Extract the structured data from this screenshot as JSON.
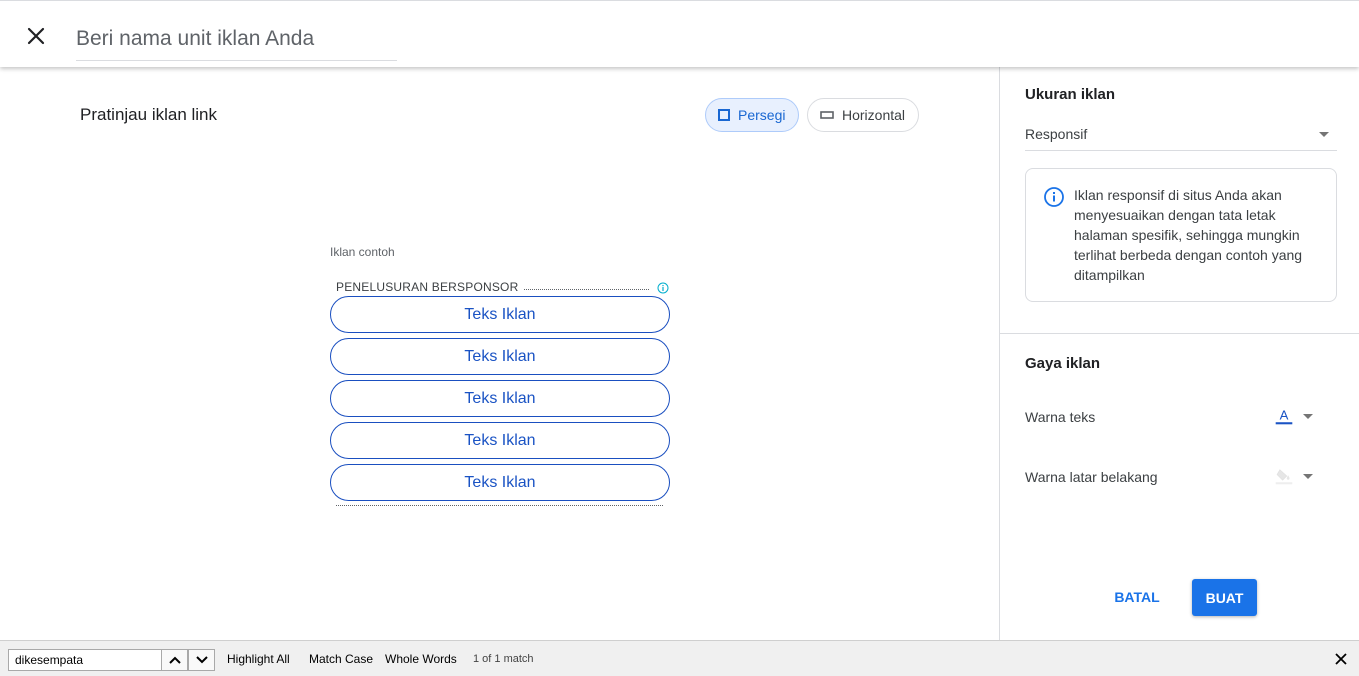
{
  "header": {
    "name_placeholder": "Beri nama unit iklan Anda"
  },
  "preview": {
    "title": "Pratinjau iklan link",
    "chips": {
      "square": "Persegi",
      "horizontal": "Horizontal"
    },
    "sample_label": "Iklan contoh",
    "sponsored_label": "PENELUSURAN BERSPONSOR",
    "ad_items": [
      "Teks Iklan",
      "Teks Iklan",
      "Teks Iklan",
      "Teks Iklan",
      "Teks Iklan"
    ],
    "ad_text_color": "#1a53c4"
  },
  "side": {
    "size_heading": "Ukuran iklan",
    "size_value": "Responsif",
    "info_text": "Iklan responsif di situs Anda akan menyesuaikan dengan tata letak halaman spesifik, sehingga mungkin terlihat berbeda dengan contoh yang ditampilkan",
    "style_heading": "Gaya iklan",
    "text_color_label": "Warna teks",
    "text_color_glyph": "A",
    "text_color_value": "#1a53c4",
    "bg_color_label": "Warna latar belakang",
    "bg_color_value": "#eeeeee",
    "cancel_label": "BATAL",
    "create_label": "BUAT",
    "accent_color": "#1a73e8"
  },
  "findbar": {
    "query": "dikesempata",
    "highlight_all": "Highlight All",
    "match_case": "Match Case",
    "whole_words": "Whole Words",
    "match_count": "1 of 1 match"
  }
}
